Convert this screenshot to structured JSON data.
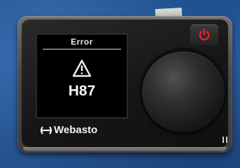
{
  "display": {
    "title": "Error",
    "code": "H87"
  },
  "brand": {
    "name": "Webasto"
  },
  "icons": {
    "warning": "warning-triangle-icon",
    "power": "power-icon"
  },
  "colors": {
    "power_led": "#e8272d",
    "screen_background": "#000000",
    "screen_text": "#f0f0f0"
  }
}
